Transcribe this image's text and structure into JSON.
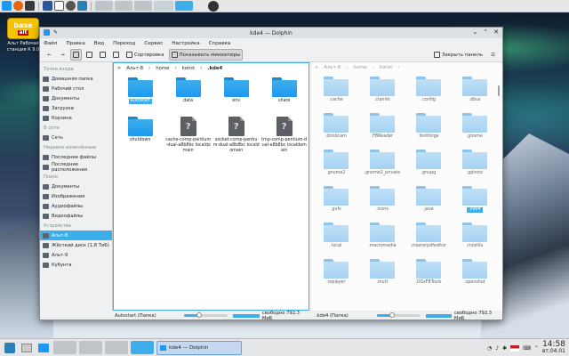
{
  "window": {
    "title": "kde4 — Dolphin"
  },
  "desktop": {
    "logo_main": "base",
    "logo_alt": "alt",
    "label": "Альт Рабочая станция К 9.0"
  },
  "menu": [
    "Файл",
    "Правка",
    "Вид",
    "Переход",
    "Сервис",
    "Настройка",
    "Справка"
  ],
  "toolbar": {
    "sort": "Сортировка",
    "preview": "Показывать миниатюры",
    "close_panel": "Закрыть панель"
  },
  "sidebar": {
    "sections": [
      {
        "head": "Точки входа",
        "items": [
          "Домашняя папка",
          "Рабочий стол",
          "Документы",
          "Загрузки",
          "Корзина"
        ]
      },
      {
        "head": "В сети",
        "items": [
          "Сеть"
        ]
      },
      {
        "head": "Недавно изменённые",
        "items": [
          "Последние файлы",
          "Последние расположения"
        ]
      },
      {
        "head": "Поиск",
        "items": [
          "Документы",
          "Изображения",
          "Аудиофайлы",
          "Видеофайлы"
        ]
      },
      {
        "head": "Устройства",
        "items": [
          "Альт-8",
          "Жёсткий диск (1,8 ТиБ)",
          "Альт-9",
          "Кубунта"
        ]
      }
    ],
    "selected": "Альт-8"
  },
  "left_pane": {
    "crumbs": [
      "Альт-8",
      "home",
      "konst",
      ".kde4"
    ],
    "items": [
      {
        "name": "Autostart",
        "type": "folder",
        "selected": true
      },
      {
        "name": "data",
        "type": "folder"
      },
      {
        "name": "env",
        "type": "folder"
      },
      {
        "name": "share",
        "type": "folder"
      },
      {
        "name": "shutdown",
        "type": "folder"
      },
      {
        "name": "cache-comp-pentium-dual-a8b8bc localdomain",
        "type": "file"
      },
      {
        "name": "socket-comp-pentium-dual-a8b8bc localdomain",
        "type": "file"
      },
      {
        "name": "tmp-comp-pentium-dual-a8b8bc localdomain",
        "type": "file"
      }
    ],
    "status": "Autostart (Папка)",
    "free": "свободно 792,3 МиБ"
  },
  "right_pane": {
    "crumbs": [
      "Альт-8",
      "home",
      "konst"
    ],
    "items": [
      ".cache",
      ".clamtk",
      ".config",
      ".dbus",
      ".droidcam",
      ".FBReader",
      ".fontforge",
      ".gnome",
      ".gnome2",
      ".gnome2_private",
      ".gnupg",
      ".gphoto",
      ".gvfs",
      ".icons",
      ".java",
      ".kde4",
      ".local",
      ".macromedia",
      ".masterpdfeditor",
      ".mozilla",
      ".mplayer",
      ".mutt",
      ".OGsFBTools",
      ".openshot"
    ],
    "selected": ".kde4",
    "status": ".kde4 (Папка)",
    "free": "свободно 792,3 МиБ"
  },
  "taskbar": {
    "task": "kde4 — Dolphin",
    "time": "14:58",
    "date": "вт,04.01"
  },
  "colors": {
    "accent": "#3daee9",
    "folder": "#1d99f3"
  }
}
